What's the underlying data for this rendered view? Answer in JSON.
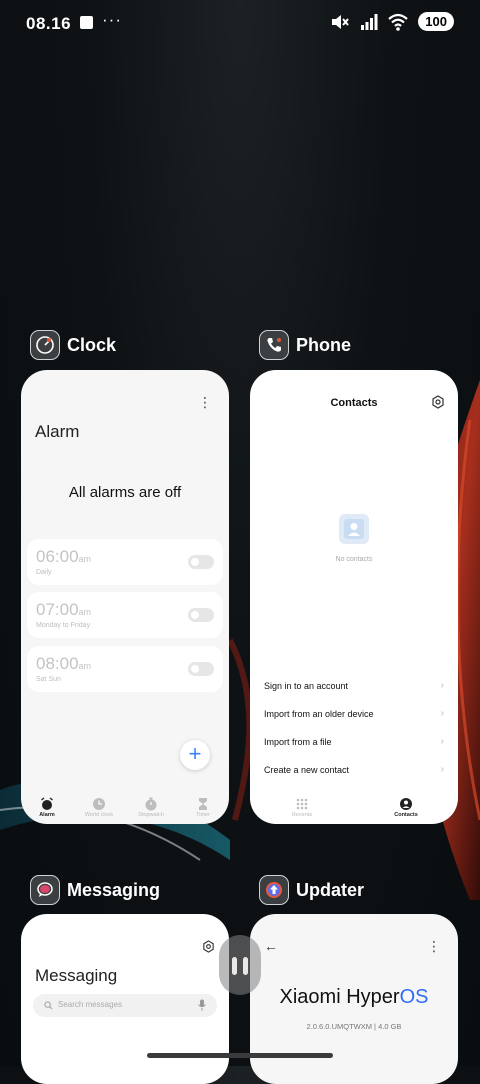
{
  "status_bar": {
    "time": "08.16",
    "overflow": "···",
    "battery": "100",
    "icons": [
      "screenshot-square-icon",
      "mute-icon",
      "signal-icon",
      "wifi-icon"
    ]
  },
  "apps": {
    "clock": {
      "name": "Clock",
      "screen_title": "Alarm",
      "empty_text": "All alarms are off",
      "alarms": [
        {
          "time": "06:00",
          "ampm": "am",
          "days": "Daily",
          "enabled": false
        },
        {
          "time": "07:00",
          "ampm": "am",
          "days": "Monday to Friday",
          "enabled": false
        },
        {
          "time": "08:00",
          "ampm": "am",
          "days": "Sat Sun",
          "enabled": false
        }
      ],
      "fab": "+",
      "tabs": [
        "Alarm",
        "World clock",
        "Stopwatch",
        "Timer"
      ]
    },
    "phone": {
      "name": "Phone",
      "screen_title": "Contacts",
      "empty_text": "No contacts",
      "actions": [
        "Sign in to an account",
        "Import from an older device",
        "Import from a file",
        "Create a new contact"
      ],
      "tabs": [
        "Recents",
        "Contacts"
      ]
    },
    "messaging": {
      "name": "Messaging",
      "screen_title": "Messaging",
      "search_placeholder": "Search messages"
    },
    "updater": {
      "name": "Updater",
      "brand_a": "Xiaomi Hyper",
      "brand_b": "OS",
      "version": "2.0.6.0.UMQTWXM | 4.0 GB"
    }
  },
  "colors": {
    "accent": "#2f6df6",
    "fab": "#3b82f6"
  }
}
